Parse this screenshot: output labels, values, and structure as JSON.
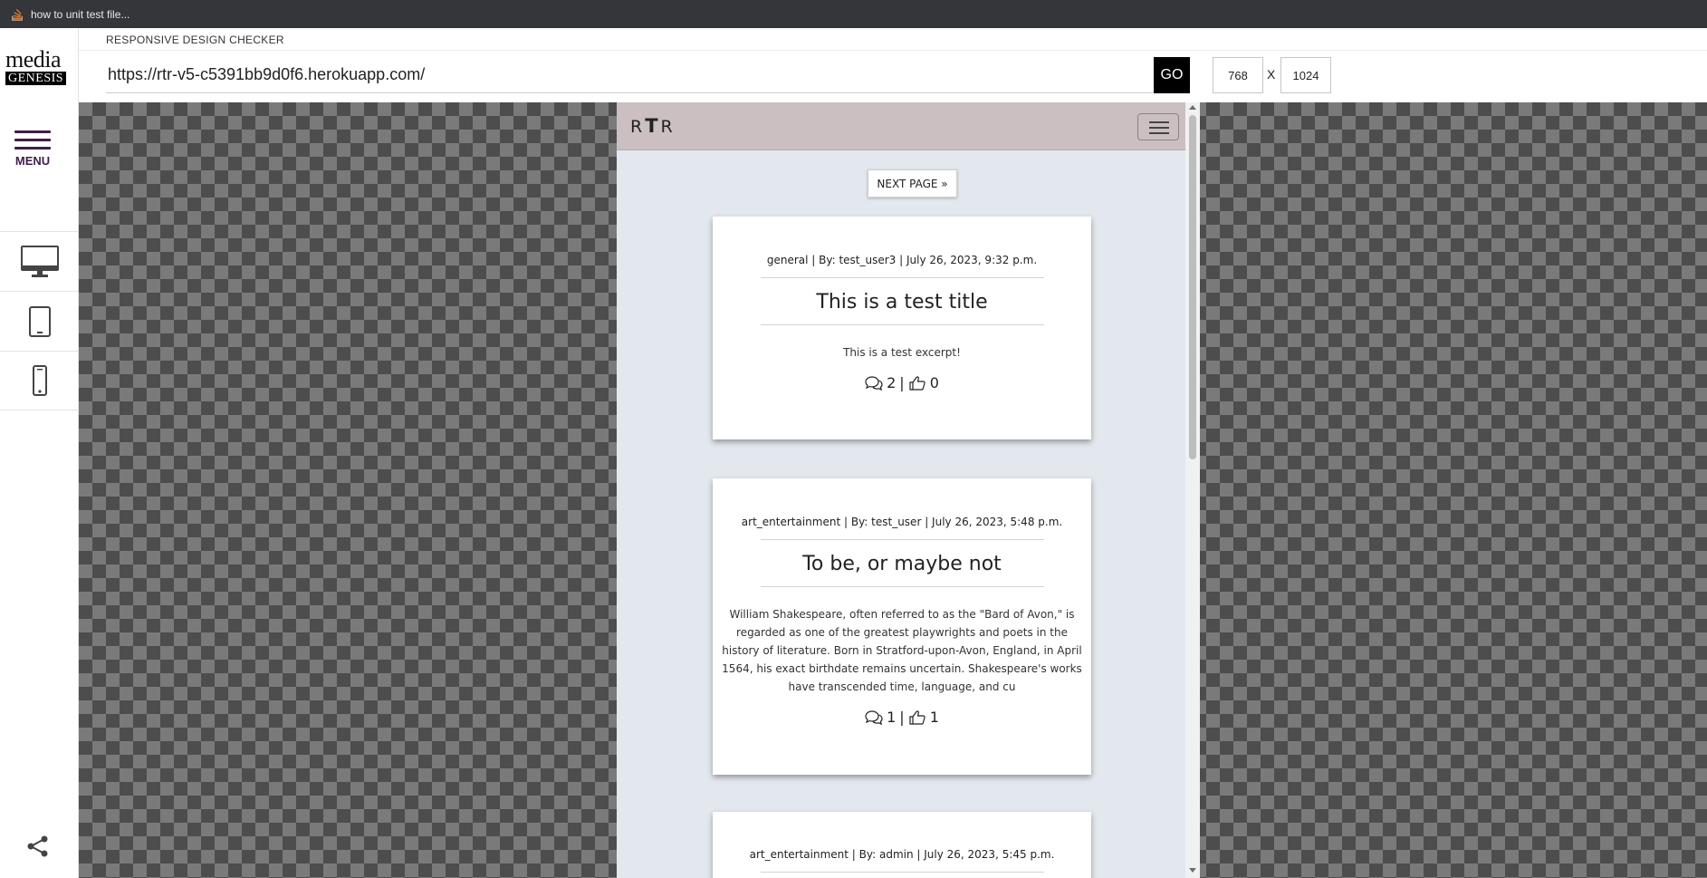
{
  "bookmarks_bar": {
    "tab_label": "how to unit test file..."
  },
  "logo": {
    "line1": "media",
    "line2": "GENESIS"
  },
  "rail": {
    "menu_label": "MENU",
    "devices": [
      "desktop-icon",
      "tablet-icon",
      "phone-icon"
    ],
    "share_icon": "share-icon"
  },
  "header": {
    "title": "RESPONSIVE DESIGN CHECKER",
    "url": "https://rtr-v5-c5391bb9d0f6.herokuapp.com/",
    "go_label": "GO",
    "width": "768",
    "separator": "X",
    "height": "1024"
  },
  "site": {
    "brand_left": "R",
    "brand_mid": "T",
    "brand_right": "R",
    "nav_bg": "#cbbfc1",
    "page_bg": "#e2e8ee",
    "next_page_label": "NEXT PAGE »",
    "posts": [
      {
        "meta": "general | By: test_user3 | July 26, 2023, 9:32 p.m.",
        "title": "This is a test title",
        "excerpt": "This is a test excerpt!",
        "comments": "2",
        "divider": "|",
        "likes": "0"
      },
      {
        "meta": "art_entertainment | By: test_user | July 26, 2023, 5:48 p.m.",
        "title": "To be, or maybe not",
        "excerpt": "William Shakespeare, often referred to as the \"Bard of Avon,\" is regarded as one of the greatest playwrights and poets in the history of literature. Born in Stratford-upon-Avon, England, in April 1564, his exact birthdate remains uncertain. Shakespeare's works have transcended time, language, and cu",
        "comments": "1",
        "divider": "|",
        "likes": "1"
      },
      {
        "meta": "art_entertainment | By: admin | July 26, 2023, 5:45 p.m."
      }
    ]
  }
}
